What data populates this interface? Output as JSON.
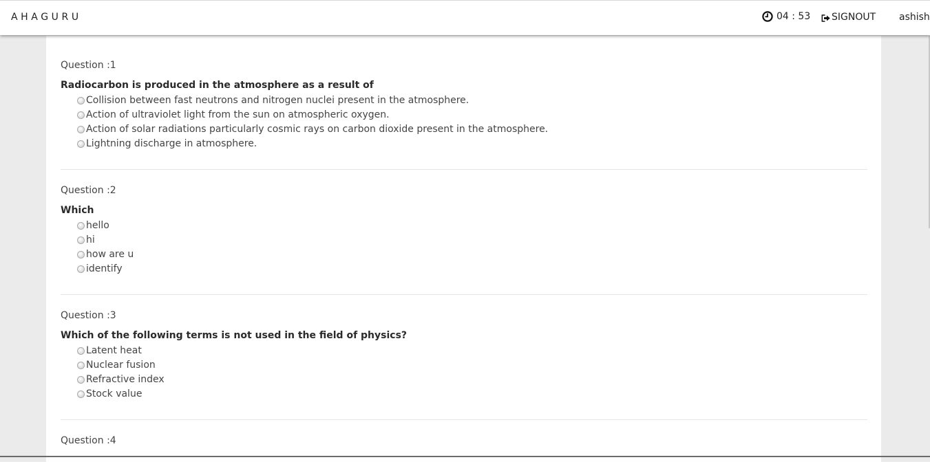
{
  "header": {
    "brand": "AHAGURU",
    "timer": "04 : 53",
    "signout_label": "SIGNOUT",
    "username": "ashish"
  },
  "questions": [
    {
      "number_label": "Question :1",
      "text": "Radiocarbon is produced in the atmosphere as a result of",
      "options": [
        "Collision between fast neutrons and nitrogen nuclei present in the atmosphere.",
        "Action of ultraviolet light from the sun on atmospheric oxygen.",
        "Action of solar radiations particularly cosmic rays on carbon dioxide present in the atmosphere.",
        "Lightning discharge in atmosphere."
      ]
    },
    {
      "number_label": "Question :2",
      "text": "Which",
      "options": [
        "hello",
        "hi",
        "how are u",
        "identify"
      ]
    },
    {
      "number_label": "Question :3",
      "text": "Which of the following terms is not used in the field of physics?",
      "options": [
        "Latent heat",
        "Nuclear fusion",
        "Refractive index",
        "Stock value"
      ]
    },
    {
      "number_label": "Question :4"
    }
  ],
  "icons": {
    "timer": "clock-icon",
    "signout": "signout-icon"
  }
}
